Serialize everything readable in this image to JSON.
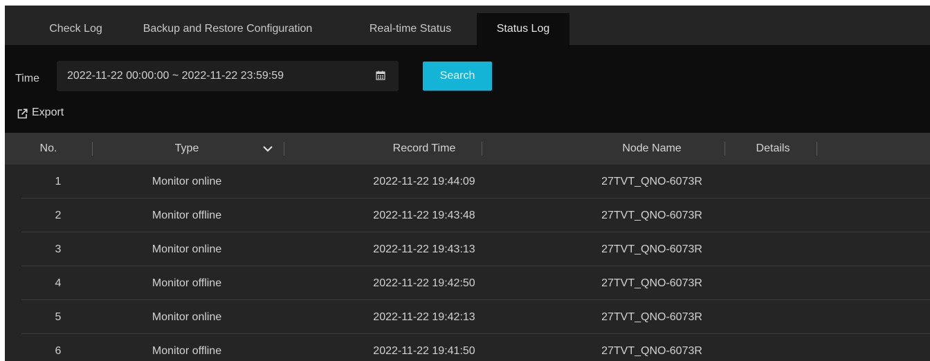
{
  "tabs": [
    {
      "label": "Check Log",
      "active": false
    },
    {
      "label": "Backup and Restore Configuration",
      "active": false
    },
    {
      "label": "Real-time Status",
      "active": false
    },
    {
      "label": "Status Log",
      "active": true
    }
  ],
  "filter": {
    "time_label": "Time",
    "date_range": "2022-11-22 00:00:00 ~ 2022-11-22 23:59:59",
    "search_label": "Search"
  },
  "export_label": "Export",
  "table": {
    "columns": [
      "No.",
      "Type",
      "Record Time",
      "Node Name",
      "Details"
    ],
    "rows": [
      {
        "no": "1",
        "type": "Monitor online",
        "time": "2022-11-22 19:44:09",
        "node": "27TVT_QNO-6073R"
      },
      {
        "no": "2",
        "type": "Monitor offline",
        "time": "2022-11-22 19:43:48",
        "node": "27TVT_QNO-6073R"
      },
      {
        "no": "3",
        "type": "Monitor online",
        "time": "2022-11-22 19:43:13",
        "node": "27TVT_QNO-6073R"
      },
      {
        "no": "4",
        "type": "Monitor offline",
        "time": "2022-11-22 19:42:50",
        "node": "27TVT_QNO-6073R"
      },
      {
        "no": "5",
        "type": "Monitor online",
        "time": "2022-11-22 19:42:13",
        "node": "27TVT_QNO-6073R"
      },
      {
        "no": "6",
        "type": "Monitor offline",
        "time": "2022-11-22 19:41:50",
        "node": "27TVT_QNO-6073R"
      }
    ]
  },
  "icons": {
    "calendar": "calendar-icon",
    "export": "export-icon",
    "type_filter": "chevron-down-icon"
  },
  "colors": {
    "accent": "#14b4d6",
    "background": "#252525",
    "toolbar": "#0d0d0d",
    "header": "#333333"
  }
}
